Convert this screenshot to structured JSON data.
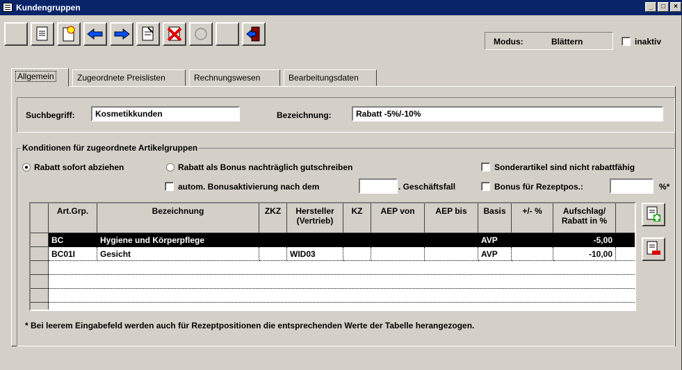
{
  "window": {
    "title": "Kundengruppen",
    "controls": [
      "_",
      "□",
      "×"
    ]
  },
  "toolbar": {
    "modus_label": "Modus:",
    "modus_value": "Blättern",
    "inaktiv_label": "inaktiv"
  },
  "tabs": [
    {
      "label": "Allgemein"
    },
    {
      "label": "Zugeordnete Preislisten"
    },
    {
      "label": "Rechnungswesen"
    },
    {
      "label": "Bearbeitungsdaten"
    }
  ],
  "search": {
    "label": "Suchbegriff:",
    "value": "Kosmetikkunden",
    "bez_label": "Bezeichnung:",
    "bez_value": "Rabatt -5%/-10%"
  },
  "conditions": {
    "title": "Konditionen für zugeordnete Artikelgruppen",
    "radio1": "Rabatt sofort abziehen",
    "radio2": "Rabatt als Bonus nachträglich gutschreiben",
    "sonder": "Sonderartikel sind nicht rabattfähig",
    "autom": "autom. Bonusaktivierung nach dem",
    "geschaeft": ". Geschäftsfall",
    "bonus_rezept": "Bonus für Rezeptpos.:",
    "pct": "%*"
  },
  "table": {
    "columns": [
      "Art.Grp.",
      "Bezeichnung",
      "ZKZ",
      "Hersteller (Vertrieb)",
      "KZ",
      "AEP von",
      "AEP bis",
      "Basis",
      "+/- %",
      "Aufschlag/ Rabatt in %"
    ],
    "rows": [
      {
        "artgrp": "BC",
        "bez": "Hygiene und Körperpflege",
        "zkz": "",
        "hersteller": "",
        "kz": "",
        "aep_von": "",
        "aep_bis": "",
        "basis": "AVP",
        "pm": "",
        "rabatt": "-5,00"
      },
      {
        "artgrp": "BC01I",
        "bez": "Gesicht",
        "zkz": "",
        "hersteller": "WID03",
        "kz": "",
        "aep_von": "",
        "aep_bis": "",
        "basis": "AVP",
        "pm": "",
        "rabatt": "-10,00"
      }
    ]
  },
  "footnote": "* Bei leerem Eingabefeld werden auch für Rezeptpositionen die entsprechenden Werte der Tabelle herangezogen."
}
